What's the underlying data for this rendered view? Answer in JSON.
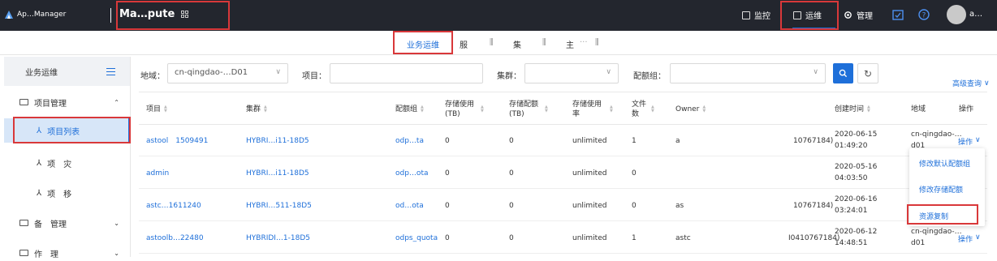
{
  "topbar": {
    "app_name": "Ap…Manager",
    "product": "Ma…pute",
    "nav": {
      "monitor": "监控",
      "ops": "运维",
      "manage": "管理"
    },
    "user": "a…"
  },
  "subtabs": [
    "业务运维",
    "服",
    "集",
    "主"
  ],
  "sidebar": {
    "title": "业务运维",
    "groups": [
      {
        "label": "项目管理",
        "items": [
          "项目列表",
          "项　灾",
          "项　移"
        ]
      },
      {
        "label": "备　管理"
      },
      {
        "label": "作　理"
      }
    ]
  },
  "filters": {
    "region_label": "地域：",
    "region_value": "cn-qingdao-…D01",
    "project_label": "项目：",
    "cluster_label": "集群：",
    "quota_label": "配额组："
  },
  "advanced_search": "高级查询",
  "table": {
    "columns": [
      "项目",
      "集群",
      "配额组",
      "存储使用(TB)",
      "存储配额(TB)",
      "存储使用率",
      "文件数",
      "Owner",
      "创建时间",
      "地域",
      "操作"
    ],
    "rows": [
      {
        "project": "astool　1509491",
        "cluster": "HYBRI…i11-18D5",
        "quota": "odp…ta",
        "storage_used": "0",
        "storage_quota": "0",
        "usage_rate": "unlimited",
        "files": "1",
        "owner": "a",
        "owner_tail": "10767184)",
        "created_date": "2020-06-15",
        "created_time": "01:49:20",
        "region_line1": "cn-qingdao-…",
        "region_line2": "d01",
        "op": "操作"
      },
      {
        "project": "admin",
        "cluster": "HYBRI…i11-18D5",
        "quota": "odp…ota",
        "storage_used": "0",
        "storage_quota": "0",
        "usage_rate": "unlimited",
        "files": "0",
        "owner": "",
        "owner_tail": "",
        "created_date": "2020-05-16",
        "created_time": "04:03:50",
        "region_line1": "",
        "region_line2": "",
        "op": ""
      },
      {
        "project": "astc…1611240",
        "cluster": "HYBRI…511-18D5",
        "quota": "od…ota",
        "storage_used": "0",
        "storage_quota": "0",
        "usage_rate": "unlimited",
        "files": "0",
        "owner": "as",
        "owner_tail": "10767184)",
        "created_date": "2020-06-16",
        "created_time": "03:24:01",
        "region_line1": "",
        "region_line2": "",
        "op": ""
      },
      {
        "project": "astoolb…22480",
        "cluster": "HYBRIDI…1-18D5",
        "quota": "odps_quota",
        "storage_used": "0",
        "storage_quota": "0",
        "usage_rate": "unlimited",
        "files": "1",
        "owner": "astc",
        "owner_tail": "I0410767184)",
        "created_date": "2020-06-12",
        "created_time": "14:48:51",
        "region_line1": "cn-qingdao-…",
        "region_line2": "d01",
        "op": "操作"
      }
    ]
  },
  "dropdown": [
    "修改默认配额组",
    "修改存储配额",
    "资源复制"
  ],
  "colors": {
    "topbar": "#23262e",
    "accent": "#1e6fd9",
    "highlight": "#d9383a",
    "sidebar_active": "#d7e6f8"
  }
}
